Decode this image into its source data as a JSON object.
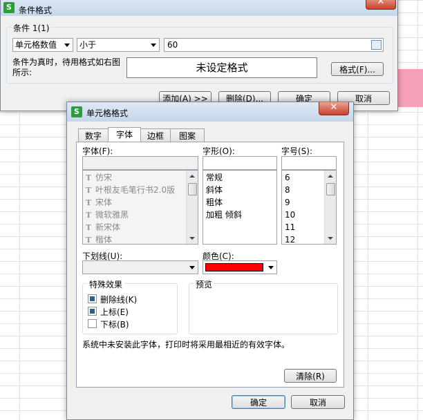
{
  "cond_dialog": {
    "title": "条件格式",
    "group_label": "条件 1(1)",
    "type_value": "单元格数值",
    "operator_value": "小于",
    "value": "60",
    "preview_label": "条件为真时，待用格式如右图所示:",
    "preview_text": "未设定格式",
    "format_button": "格式(F)...",
    "add_button": "添加(A) >>",
    "delete_button": "删除(D)...",
    "ok_button": "确定",
    "cancel_button": "取消"
  },
  "cell_dialog": {
    "title": "单元格格式",
    "tabs": [
      "数字",
      "字体",
      "边框",
      "图案"
    ],
    "active_tab": "字体",
    "font_label": "字体(F):",
    "style_label": "字形(O):",
    "size_label": "字号(S):",
    "fonts": [
      "仿宋",
      "叶根友毛笔行书2.0版",
      "宋体",
      "微软雅黑",
      "新宋体",
      "楷体"
    ],
    "styles": [
      "常规",
      "斜体",
      "粗体",
      "加粗 倾斜"
    ],
    "sizes": [
      "6",
      "8",
      "9",
      "10",
      "11",
      "12"
    ],
    "underline_label": "下划线(U):",
    "color_label": "颜色(C):",
    "color_value": "#ff0000",
    "effects_label": "特殊效果",
    "strikethrough": {
      "label": "删除线(K)",
      "checked": true
    },
    "superscript": {
      "label": "上标(E)",
      "checked": true
    },
    "subscript": {
      "label": "下标(B)",
      "checked": false
    },
    "preview_label": "预览",
    "note": "系统中未安装此字体，打印时将采用最相近的有效字体。",
    "clear_button": "清除(R)",
    "ok_button": "确定",
    "cancel_button": "取消"
  },
  "colors": {
    "accent": "#3c7fb1",
    "app_icon": "#2e9b3d",
    "highlight": "#f5a0b8",
    "close": "#c7432c"
  }
}
